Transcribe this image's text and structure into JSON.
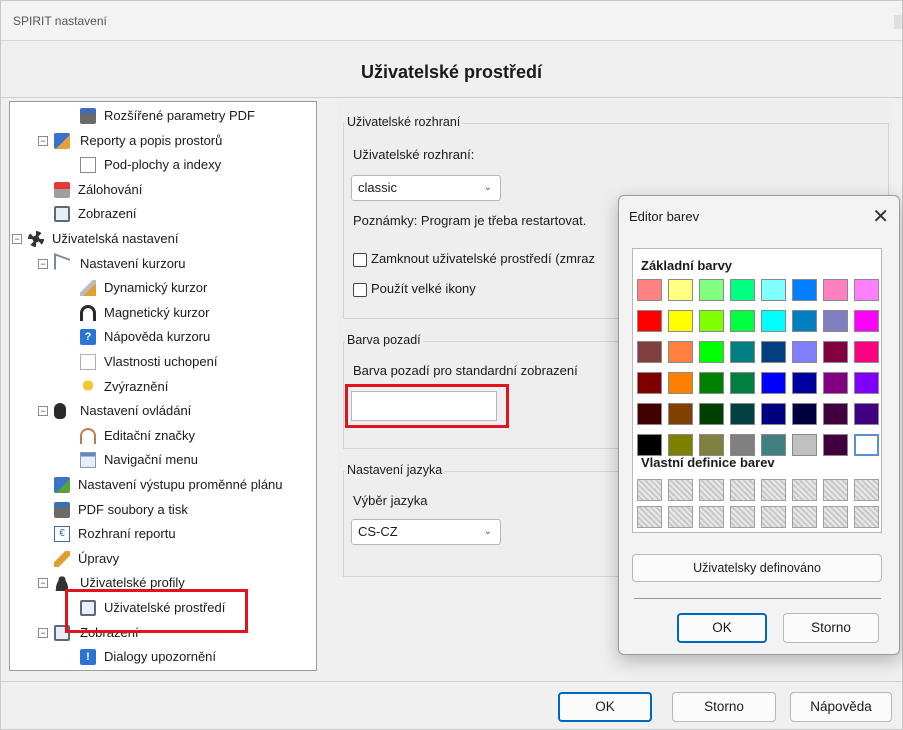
{
  "window": {
    "title": "SPIRIT nastavení"
  },
  "header": {
    "title": "Uživatelské prostředí"
  },
  "tree": {
    "items": [
      {
        "label": "Rozšířené parametry PDF",
        "icon": "printer-icon",
        "expander": ""
      },
      {
        "label": "Reporty a popis prostorů",
        "icon": "report-icon",
        "expander": "⊟"
      },
      {
        "label": "Pod-plochy a indexy",
        "icon": "sheet-icon",
        "expander": ""
      },
      {
        "label": "Zálohování",
        "icon": "backup-icon",
        "expander": ""
      },
      {
        "label": "Zobrazení",
        "icon": "monitor-icon",
        "expander": ""
      },
      {
        "label": "Uživatelská nastavení",
        "icon": "gear-icon",
        "expander": "⊟"
      },
      {
        "label": "Nastavení kurzoru",
        "icon": "cursor-icon",
        "expander": "⊟"
      },
      {
        "label": "Dynamický kurzor",
        "icon": "dynamic-cursor-icon",
        "expander": ""
      },
      {
        "label": "Magnetický kurzor",
        "icon": "magnet-icon",
        "expander": ""
      },
      {
        "label": "Nápověda kurzoru",
        "icon": "help-icon",
        "expander": ""
      },
      {
        "label": "Vlastnosti uchopení",
        "icon": "snap-icon",
        "expander": ""
      },
      {
        "label": "Zvýraznění",
        "icon": "bulb-icon",
        "expander": ""
      },
      {
        "label": "Nastavení ovládání",
        "icon": "mouse-icon",
        "expander": "⊟"
      },
      {
        "label": "Editační značky",
        "icon": "edit-marks-icon",
        "expander": ""
      },
      {
        "label": "Navigační menu",
        "icon": "nav-menu-icon",
        "expander": ""
      },
      {
        "label": "Nastavení výstupu proměnné plánu",
        "icon": "output-icon",
        "expander": ""
      },
      {
        "label": "PDF soubory a tisk",
        "icon": "printer-icon",
        "expander": ""
      },
      {
        "label": "Rozhraní reportu",
        "icon": "euro-icon",
        "expander": ""
      },
      {
        "label": "Úpravy",
        "icon": "pencil-icon",
        "expander": ""
      },
      {
        "label": "Uživatelské profily",
        "icon": "user-icon",
        "expander": "⊟"
      },
      {
        "label": "Uživatelské prostředí",
        "icon": "monitor-icon",
        "expander": ""
      },
      {
        "label": "Zobrazení",
        "icon": "monitor-icon",
        "expander": "⊟"
      },
      {
        "label": "Dialogy upozornění",
        "icon": "warning-icon",
        "expander": ""
      }
    ]
  },
  "ui_group": {
    "label": "Uživatelské rozhraní",
    "field_label": "Uživatelské rozhraní:",
    "select_value": "classic",
    "note": "Poznámky: Program je třeba restartovat.",
    "lock_label": "Zamknout uživatelské prostředí (zmraz",
    "big_icons_label": "Použít velké ikony"
  },
  "bg_group": {
    "label": "Barva pozadí",
    "field_label": "Barva pozadí pro standardní zobrazení",
    "value_color": "#ffffff"
  },
  "lang_group": {
    "label": "Nastavení jazyka",
    "field_label": "Výběr jazyka",
    "select_value": "CS-CZ"
  },
  "footer": {
    "ok": "OK",
    "cancel": "Storno",
    "help": "Nápověda"
  },
  "color_dialog": {
    "title": "Editor barev",
    "basic_label": "Základní barvy",
    "custom_label": "Vlastní definice barev",
    "define_button": "Uživatelsky definováno",
    "ok": "OK",
    "cancel": "Storno",
    "basic_colors": [
      [
        "#ff8080",
        "#ffff80",
        "#80ff80",
        "#00ff80",
        "#80ffff",
        "#0080ff",
        "#ff80c0",
        "#ff80ff"
      ],
      [
        "#ff0000",
        "#ffff00",
        "#80ff00",
        "#00ff40",
        "#00ffff",
        "#0080c0",
        "#8080c0",
        "#ff00ff"
      ],
      [
        "#804040",
        "#ff8040",
        "#00ff00",
        "#008080",
        "#004080",
        "#8080ff",
        "#800040",
        "#ff0080"
      ],
      [
        "#800000",
        "#ff8000",
        "#008000",
        "#008040",
        "#0000ff",
        "#0000a0",
        "#800080",
        "#8000ff"
      ],
      [
        "#400000",
        "#804000",
        "#004000",
        "#004040",
        "#000080",
        "#000040",
        "#400040",
        "#400080"
      ],
      [
        "#000000",
        "#808000",
        "#808040",
        "#808080",
        "#408080",
        "#c0c0c0",
        "#400040",
        "#ffffff"
      ]
    ],
    "selected_color": "#ffffff"
  }
}
